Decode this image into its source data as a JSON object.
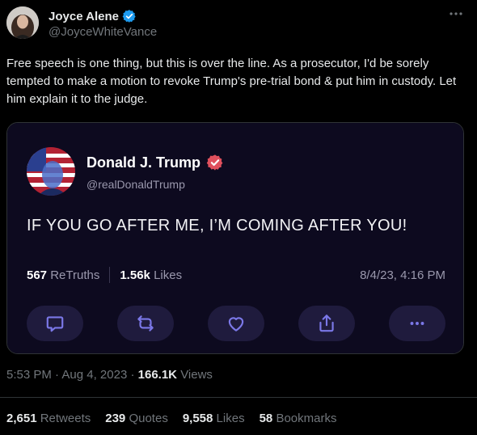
{
  "author": {
    "name": "Joyce Alene",
    "handle": "@JoyceWhiteVance",
    "more_icon": "ellipsis-icon"
  },
  "tweet": {
    "text": "Free speech is one thing, but this is over the line. As a prosecutor, I'd be sorely tempted to make a motion to revoke Trump's pre-trial bond & put him in custody. Let him explain it to the judge."
  },
  "embed": {
    "name": "Donald J. Trump",
    "handle": "@realDonaldTrump",
    "text": "IF YOU GO AFTER ME, I’M COMING AFTER YOU!",
    "retruths_count": "567",
    "retruths_label": "ReTruths",
    "likes_count": "1.56k",
    "likes_label": "Likes",
    "date": "8/4/23, 4:16 PM",
    "actions": [
      "reply-icon",
      "retruth-icon",
      "like-icon",
      "share-icon",
      "more-icon"
    ],
    "accent": "#7b78e8",
    "background": "#0d0a1f"
  },
  "meta": {
    "time": "5:53 PM",
    "separator": "·",
    "date": "Aug 4, 2023",
    "views_count": "166.1K",
    "views_label": "Views"
  },
  "engagement": {
    "retweets_count": "2,651",
    "retweets_label": "Retweets",
    "quotes_count": "239",
    "quotes_label": "Quotes",
    "likes_count": "9,558",
    "likes_label": "Likes",
    "bookmarks_count": "58",
    "bookmarks_label": "Bookmarks"
  },
  "colors": {
    "verified_blue": "#1d9bf0",
    "truth_verified": "#e0505d",
    "secondary_text": "#71767b"
  }
}
